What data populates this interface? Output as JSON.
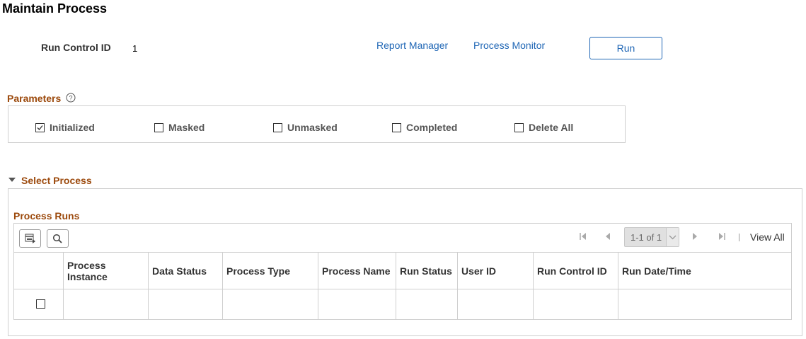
{
  "header": {
    "title": "Maintain Process",
    "run_control_label": "Run Control ID",
    "run_control_value": "1",
    "report_manager": "Report Manager",
    "process_monitor": "Process Monitor",
    "run_label": "Run"
  },
  "parameters": {
    "title": "Parameters",
    "help_icon": "help-circle-icon",
    "options": [
      {
        "label": "Initialized",
        "checked": true
      },
      {
        "label": "Masked",
        "checked": false
      },
      {
        "label": "Unmasked",
        "checked": false
      },
      {
        "label": "Completed",
        "checked": false
      },
      {
        "label": "Delete All",
        "checked": false
      }
    ]
  },
  "select_process": {
    "title": "Select Process",
    "expanded": true,
    "grid": {
      "title": "Process Runs",
      "toolbar": [
        "grid-personalize-icon",
        "search-icon"
      ],
      "pager": "1-1 of 1",
      "view_all": "View All",
      "columns": [
        "Process Instance",
        "Data Status",
        "Process Type",
        "Process Name",
        "Run Status",
        "User ID",
        "Run Control ID",
        "Run Date/Time"
      ],
      "rows": [
        {
          "selected": false,
          "cells": [
            "",
            "",
            "",
            "",
            "",
            "",
            "",
            ""
          ]
        }
      ]
    }
  },
  "colors": {
    "link": "#1f66b5",
    "section_title": "#9c4a0d",
    "border": "#cfcfcf"
  }
}
